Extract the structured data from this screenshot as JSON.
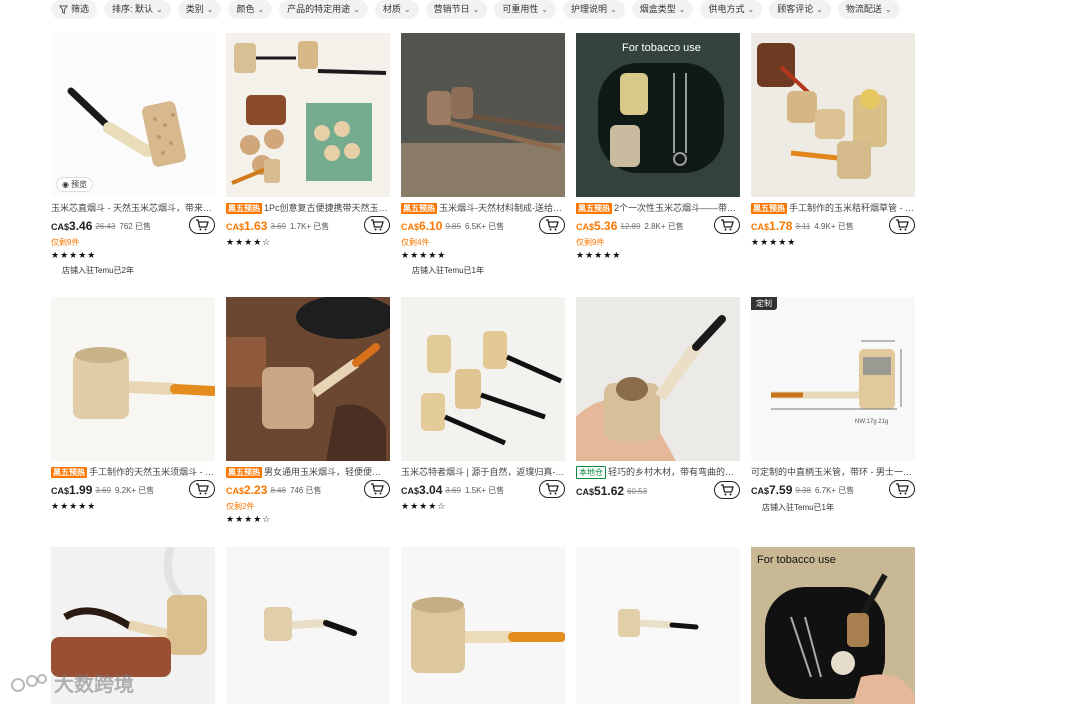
{
  "filters": [
    {
      "label": "筛选",
      "icon": "filter-icon"
    },
    {
      "label": "排序: 默认",
      "caret": true
    },
    {
      "label": "类别",
      "caret": true
    },
    {
      "label": "颜色",
      "caret": true
    },
    {
      "label": "产品的特定用途",
      "caret": true
    },
    {
      "label": "材质",
      "caret": true
    },
    {
      "label": "营销节日",
      "caret": true
    },
    {
      "label": "可重用性",
      "caret": true
    },
    {
      "label": "护理说明",
      "caret": true
    },
    {
      "label": "烟盒类型",
      "caret": true
    },
    {
      "label": "供电方式",
      "caret": true
    },
    {
      "label": "顾客评论",
      "caret": true
    },
    {
      "label": "物流配送",
      "caret": true
    }
  ],
  "products": [
    {
      "title": "玉米芯直烟斗 - 天然玉米芯烟斗，带来顺...",
      "tag": "",
      "currency": "CA$",
      "price": "3.46",
      "orig": "26.43",
      "sold": "762 已售",
      "stock": "仅剩9件",
      "stars": "★★★★★",
      "store": "店铺入驻Temu已2年",
      "preview": "预览",
      "custom": "",
      "price_color": "black",
      "image_text": ""
    },
    {
      "title": "1Pc创意复古便捷携带天然玉米...",
      "tag": "黑五预热",
      "currency": "CA$",
      "price": "1.63",
      "orig": "3.69",
      "sold": "1.7K+ 已售",
      "stock": "",
      "stars": "★★★★☆",
      "store": "",
      "preview": "",
      "custom": "",
      "price_color": "orange",
      "image_text": ""
    },
    {
      "title": "玉米烟斗-天然材料制成-送给父...",
      "tag": "黑五预热",
      "currency": "CA$",
      "price": "6.10",
      "orig": "9.85",
      "sold": "6.5K+ 已售",
      "stock": "仅剩4件",
      "stars": "★★★★★",
      "store": "店铺入驻Temu已1年",
      "preview": "",
      "custom": "",
      "price_color": "orange",
      "image_text": ""
    },
    {
      "title": "2个一次性玉米芯烟斗——带滤...",
      "tag": "黑五预热",
      "currency": "CA$",
      "price": "5.36",
      "orig": "12.89",
      "sold": "2.8K+ 已售",
      "stock": "仅剩9件",
      "stars": "★★★★★",
      "store": "",
      "preview": "",
      "custom": "",
      "price_color": "orange",
      "image_text": "For tobacco use"
    },
    {
      "title": "手工制作的玉米秸秆烟草管 - 天...",
      "tag": "黑五预热",
      "currency": "CA$",
      "price": "1.78",
      "orig": "3.11",
      "sold": "4.9K+ 已售",
      "stock": "",
      "stars": "★★★★★",
      "store": "",
      "preview": "",
      "custom": "",
      "price_color": "orange",
      "image_text": ""
    },
    {
      "title": "手工制作的天然玉米须烟斗 - 可...",
      "tag": "黑五预热",
      "currency": "CA$",
      "price": "1.99",
      "orig": "3.69",
      "sold": "9.2K+ 已售",
      "stock": "",
      "stars": "★★★★★",
      "store": "",
      "preview": "",
      "custom": "",
      "price_color": "black",
      "image_text": ""
    },
    {
      "title": "男女通用玉米烟斗，轻便便携式...",
      "tag": "黑五预热",
      "currency": "CA$",
      "price": "2.23",
      "orig": "8.48",
      "sold": "746 已售",
      "stock": "仅剩2件",
      "stars": "★★★★☆",
      "store": "",
      "preview": "",
      "custom": "",
      "price_color": "orange",
      "image_text": ""
    },
    {
      "title": "玉米芯特者烟斗 | 源于自然，返璞归真---...",
      "tag": "",
      "currency": "CA$",
      "price": "3.04",
      "orig": "3.69",
      "sold": "1.5K+ 已售",
      "stock": "",
      "stars": "★★★★☆",
      "store": "",
      "preview": "",
      "custom": "",
      "price_color": "black",
      "image_text": ""
    },
    {
      "title": "轻巧的乡村木材，带有弯曲的黑色...",
      "tag": "本地仓",
      "currency": "CA$",
      "price": "51.62",
      "orig": "60.53",
      "sold": "",
      "stock": "",
      "stars": "",
      "store": "",
      "preview": "",
      "custom": "",
      "price_color": "black",
      "image_text": ""
    },
    {
      "title": "可定制的中直柄玉米管，带环 - 男士一次...",
      "tag": "",
      "currency": "CA$",
      "price": "7.59",
      "orig": "9.38",
      "sold": "6.7K+ 已售",
      "stock": "",
      "stars": "",
      "store": "店铺入驻Temu已1年",
      "preview": "",
      "custom": "定制",
      "price_color": "black",
      "image_text": "NW:17g 21g"
    },
    {
      "image_text": ""
    },
    {
      "image_text": ""
    },
    {
      "image_text": ""
    },
    {
      "image_text": ""
    },
    {
      "image_text": "For tobacco use"
    }
  ],
  "watermark": "大数跨境",
  "colors": {
    "accent": "#fb7701",
    "local": "#0a8a3d"
  }
}
